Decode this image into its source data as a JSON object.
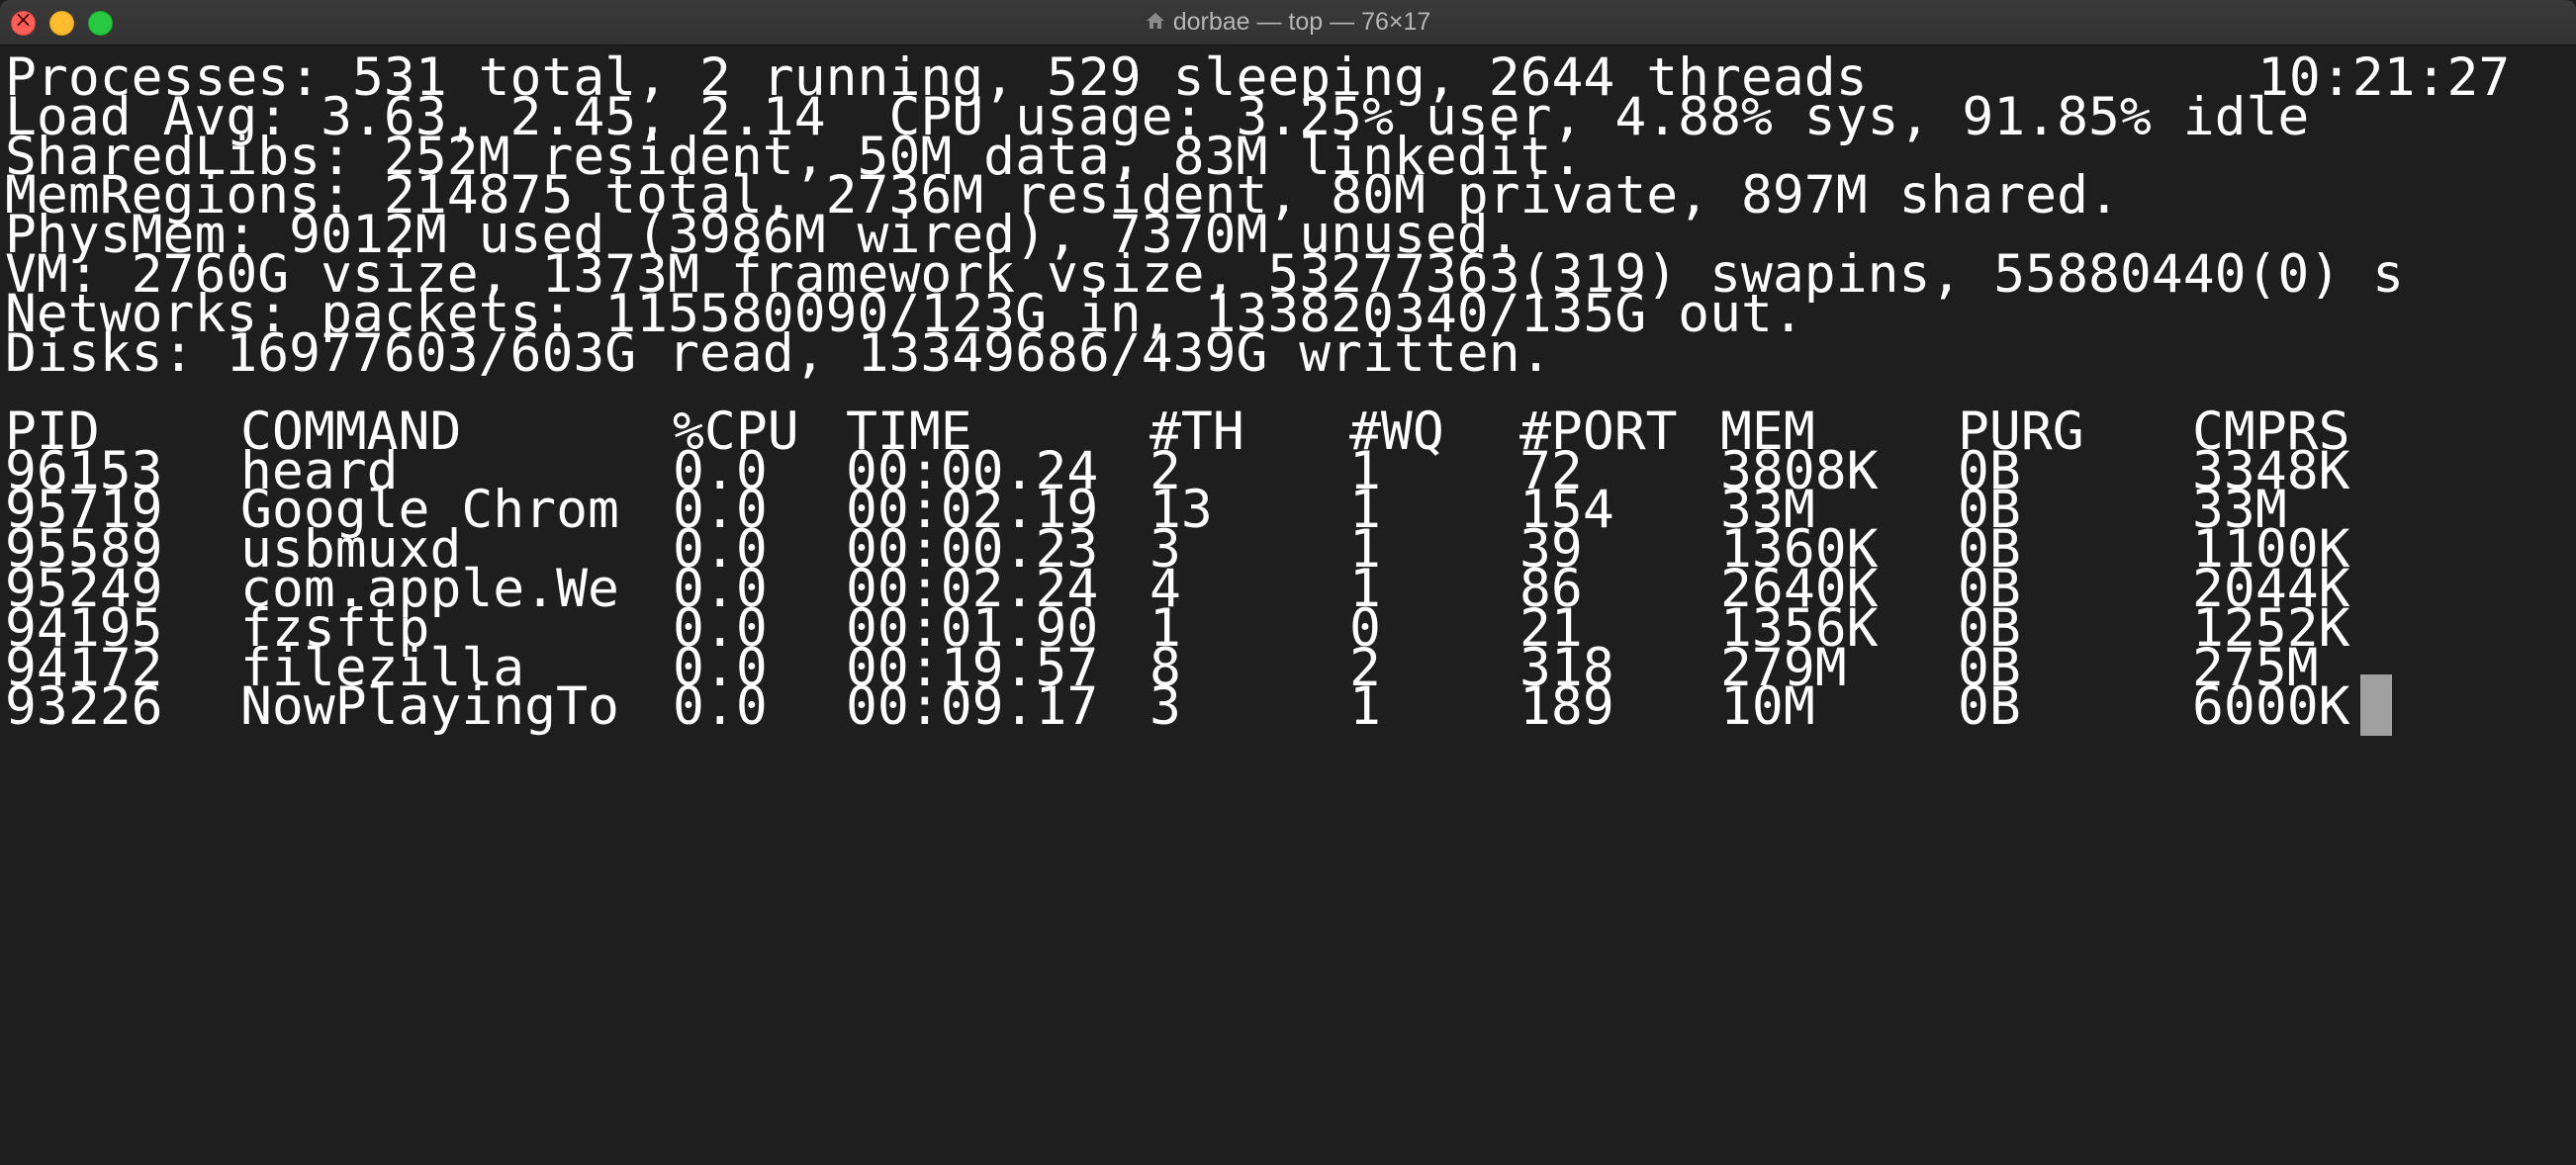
{
  "window": {
    "title": "dorbae — top — 76×17"
  },
  "summary": {
    "processes": "Processes: 531 total, 2 running, 529 sleeping, 2644 threads",
    "clock": "10:21:27",
    "load": "Load Avg: 3.63, 2.45, 2.14  CPU usage: 3.25% user, 4.88% sys, 91.85% idle",
    "sharedlibs": "SharedLibs: 252M resident, 50M data, 83M linkedit.",
    "memregions": "MemRegions: 214875 total, 2736M resident, 80M private, 897M shared.",
    "physmem": "PhysMem: 9012M used (3986M wired), 7370M unused.",
    "vm": "VM: 2760G vsize, 1373M framework vsize, 53277363(319) swapins, 55880440(0) s",
    "networks": "Networks: packets: 115580090/123G in, 133820340/135G out.",
    "disks": "Disks: 16977603/603G read, 13349686/439G written."
  },
  "table": {
    "headers": {
      "pid": "PID",
      "command": "COMMAND",
      "cpu": "%CPU",
      "time": "TIME",
      "th": "#TH",
      "wq": "#WQ",
      "port": "#PORT",
      "mem": "MEM",
      "purg": "PURG",
      "cmprs": "CMPRS"
    },
    "rows": [
      {
        "pid": "96153",
        "command": "heard",
        "cpu": "0.0",
        "time": "00:00.24",
        "th": "2",
        "wq": "1",
        "port": "72",
        "mem": "3808K",
        "purg": "0B",
        "cmprs": "3348K"
      },
      {
        "pid": "95719",
        "command": "Google Chrom",
        "cpu": "0.0",
        "time": "00:02.19",
        "th": "13",
        "wq": "1",
        "port": "154",
        "mem": "33M",
        "purg": "0B",
        "cmprs": "33M"
      },
      {
        "pid": "95589",
        "command": "usbmuxd",
        "cpu": "0.0",
        "time": "00:00.23",
        "th": "3",
        "wq": "1",
        "port": "39",
        "mem": "1360K",
        "purg": "0B",
        "cmprs": "1100K"
      },
      {
        "pid": "95249",
        "command": "com.apple.We",
        "cpu": "0.0",
        "time": "00:02.24",
        "th": "4",
        "wq": "1",
        "port": "86",
        "mem": "2640K",
        "purg": "0B",
        "cmprs": "2044K"
      },
      {
        "pid": "94195",
        "command": "fzsftp",
        "cpu": "0.0",
        "time": "00:01.90",
        "th": "1",
        "wq": "0",
        "port": "21",
        "mem": "1356K",
        "purg": "0B",
        "cmprs": "1252K"
      },
      {
        "pid": "94172",
        "command": "filezilla",
        "cpu": "0.0",
        "time": "00:19.57",
        "th": "8",
        "wq": "2",
        "port": "318",
        "mem": "279M",
        "purg": "0B",
        "cmprs": "275M"
      },
      {
        "pid": "93226",
        "command": "NowPlayingTo",
        "cpu": "0.0",
        "time": "00:09.17",
        "th": "3",
        "wq": "1",
        "port": "189",
        "mem": "10M",
        "purg": "0B",
        "cmprs": "6000K"
      }
    ]
  }
}
